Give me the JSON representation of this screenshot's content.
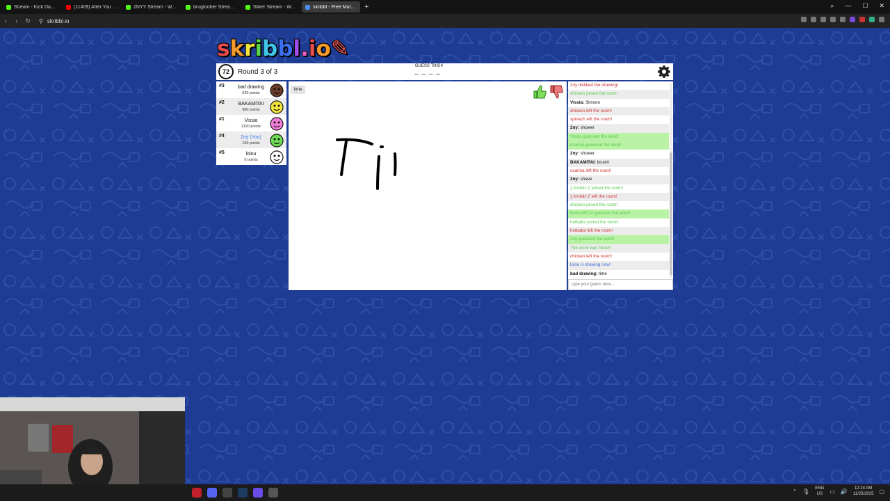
{
  "browser": {
    "tabs": [
      {
        "label": "Stream - Kick Dashboard",
        "color": "#53fc18",
        "active": false
      },
      {
        "label": "(11409) After You - Ka",
        "color": "#ff0000",
        "active": false
      },
      {
        "label": "2NYY Stream - Watch Live",
        "color": "#53fc18",
        "active": false
      },
      {
        "label": "brugtoober Stream - Watc",
        "color": "#53fc18",
        "active": false
      },
      {
        "label": "Sliker Stream - Watch Live",
        "color": "#53fc18",
        "active": false
      },
      {
        "label": "skribbl - Free Multiplayer",
        "color": "#4a8ef5",
        "active": true
      }
    ],
    "url": "skribbl.io"
  },
  "game": {
    "logo": "skribbl.io",
    "timer": "72",
    "round": "Round 3 of 3",
    "guess_label": "GUESS THIS",
    "blanks": "_ _ _ _",
    "word_length": "4"
  },
  "players": [
    {
      "rank": "#3",
      "name": "bad drawing",
      "points": "620 points",
      "you": false,
      "avatar_color": "#6b3b2a"
    },
    {
      "rank": "#2",
      "name": "BAKAMITAI",
      "points": "980 points",
      "you": false,
      "avatar_color": "#f2e33a"
    },
    {
      "rank": "#1",
      "name": "Vissia",
      "points": "1190 points",
      "you": false,
      "avatar_color": "#f07dd8"
    },
    {
      "rank": "#4",
      "name": "2ny (You)",
      "points": "150 points",
      "you": true,
      "avatar_color": "#6fdc55"
    },
    {
      "rank": "#5",
      "name": "lolou",
      "points": "0 points",
      "you": false,
      "avatar_color": "#ffffff"
    }
  ],
  "canvas": {
    "word_pill": "time"
  },
  "chat": {
    "messages": [
      {
        "type": "red",
        "author": "",
        "text": "2ny disliked the drawing!"
      },
      {
        "type": "green",
        "author": "",
        "text": "chicken joined the room!"
      },
      {
        "type": "normal",
        "author": "Vissia:",
        "text": "Simson"
      },
      {
        "type": "red",
        "author": "",
        "text": "chicken left the room!"
      },
      {
        "type": "red",
        "author": "",
        "text": "spinach left the room!"
      },
      {
        "type": "normal",
        "author": "2ny:",
        "text": "shower"
      },
      {
        "type": "greenbg",
        "author": "",
        "text": "Vissia guessed the word!"
      },
      {
        "type": "greenbg",
        "author": "",
        "text": "ocarina guessed the word!"
      },
      {
        "type": "normal",
        "author": "2ny:",
        "text": "shower"
      },
      {
        "type": "normal",
        "author": "BAKAMITAI:",
        "text": "brush\\"
      },
      {
        "type": "red",
        "author": "",
        "text": "ocarina left the room!"
      },
      {
        "type": "normal",
        "author": "2ny:",
        "text": "shave"
      },
      {
        "type": "green",
        "author": "",
        "text": "ʒ ƙmbāť ℭ joined the room!"
      },
      {
        "type": "red",
        "author": "",
        "text": "ʒ ƙmbāť ℭ left the room!"
      },
      {
        "type": "green",
        "author": "",
        "text": "chicken joined the room!"
      },
      {
        "type": "greenbg",
        "author": "",
        "text": "BAKAMITAI guessed the word!"
      },
      {
        "type": "green",
        "author": "",
        "text": "hotbabe joined the room!"
      },
      {
        "type": "red",
        "author": "",
        "text": "hotbabe left the room!"
      },
      {
        "type": "greenbg",
        "author": "",
        "text": "2ny guessed the word!"
      },
      {
        "type": "green",
        "author": "",
        "text": "The word was 'brush'"
      },
      {
        "type": "red",
        "author": "",
        "text": "chicken left the room!"
      },
      {
        "type": "blue",
        "author": "",
        "text": "lolou is drawing now!"
      },
      {
        "type": "normal",
        "author": "bad drawing:",
        "text": "time"
      }
    ],
    "input_placeholder": "Type your guess here..."
  },
  "taskbar": {
    "lang_top": "ENG",
    "lang_bottom": "US",
    "time": "12:24 AM",
    "date": "11/25/2025"
  }
}
